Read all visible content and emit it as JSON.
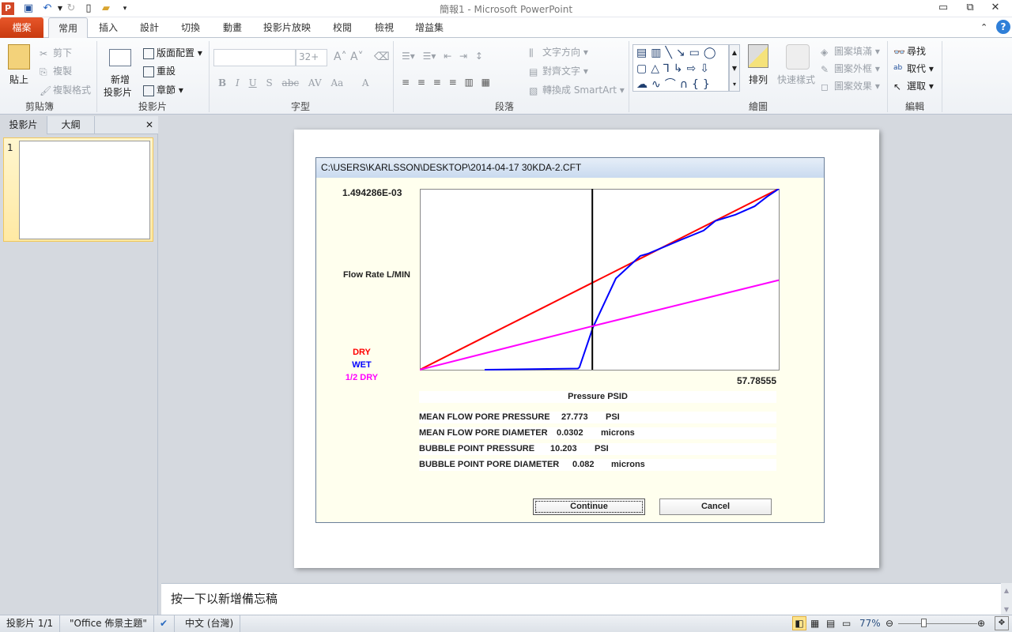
{
  "window": {
    "title": "簡報1 - Microsoft PowerPoint"
  },
  "tabs": [
    {
      "label": "檔案"
    },
    {
      "label": "常用"
    },
    {
      "label": "插入"
    },
    {
      "label": "設計"
    },
    {
      "label": "切換"
    },
    {
      "label": "動畫"
    },
    {
      "label": "投影片放映"
    },
    {
      "label": "校閱"
    },
    {
      "label": "檢視"
    },
    {
      "label": "增益集"
    }
  ],
  "ribbon": {
    "clipboard": {
      "label": "剪貼簿",
      "paste": "貼上",
      "cut": "剪下",
      "copy": "複製",
      "format_painter": "複製格式"
    },
    "slides": {
      "label": "投影片",
      "new_slide_1": "新增",
      "new_slide_2": "投影片",
      "layout": "版面配置",
      "reset": "重設",
      "section": "章節"
    },
    "font": {
      "label": "字型",
      "font_name": "",
      "font_size": "32+"
    },
    "paragraph": {
      "label": "段落",
      "text_direction": "文字方向",
      "align_text": "對齊文字",
      "smartart": "轉換成 SmartArt"
    },
    "drawing": {
      "label": "繪圖",
      "arrange": "排列",
      "quick_styles": "快速樣式",
      "shape_fill": "圖案填滿",
      "shape_outline": "圖案外框",
      "shape_effects": "圖案效果"
    },
    "editing": {
      "label": "編輯",
      "find": "尋找",
      "replace": "取代",
      "select": "選取"
    }
  },
  "left_pane": {
    "tabs": [
      "投影片",
      "大綱"
    ],
    "slide_number": "1"
  },
  "dialog": {
    "title": "C:\\USERS\\KARLSSON\\DESKTOP\\2014-04-17 30KDA-2.CFT",
    "stats": [
      {
        "label": "MEAN FLOW PORE PRESSURE",
        "value": "27.773",
        "unit": "PSI"
      },
      {
        "label": "MEAN FLOW PORE DIAMETER",
        "value": "0.0302",
        "unit": "microns"
      },
      {
        "label": "BUBBLE POINT PRESSURE",
        "value": "10.203",
        "unit": "PSI"
      },
      {
        "label": "BUBBLE POINT PORE DIAMETER",
        "value": "0.082",
        "unit": "microns"
      }
    ],
    "continue_label": "Continue",
    "cancel_label": "Cancel"
  },
  "chart_data": {
    "type": "line",
    "ylabel": "Flow Rate L/MIN",
    "xlabel": "Pressure PSID",
    "y_max_label": "1.494286E-03",
    "x_max_label": "57.78555",
    "xlim": [
      0,
      57.78555
    ],
    "ylim": [
      0,
      0.001494286
    ],
    "marker_x": 27.773,
    "series": [
      {
        "name": "DRY",
        "color": "#ff0000",
        "x": [
          0,
          10,
          20,
          27.8,
          36,
          45,
          57.79
        ],
        "y": [
          0,
          0.000259,
          0.000517,
          0.000719,
          0.000931,
          0.001164,
          0.001494
        ]
      },
      {
        "name": "WET",
        "color": "#0000ff",
        "x": [
          10.44,
          25.46,
          25.7,
          27.87,
          31.57,
          35.5,
          36.8,
          41.9,
          45.7,
          47.6,
          50.8,
          53.9,
          55.9,
          57.79
        ],
        "y": [
          0,
          1e-05,
          2e-05,
          0.00035,
          0.000754,
          0.00094,
          0.00096,
          0.00107,
          0.00115,
          0.00123,
          0.00128,
          0.00135,
          0.00143,
          0.001494
        ]
      },
      {
        "name": "1/2 DRY",
        "color": "#ff00ff",
        "x": [
          0,
          27.8,
          57.79
        ],
        "y": [
          0,
          0.00036,
          0.00074
        ]
      }
    ]
  },
  "notes": {
    "placeholder": "按一下以新增備忘稿"
  },
  "status": {
    "slide": "投影片 1/1",
    "theme": "\"Office 佈景主題\"",
    "language": "中文 (台灣)",
    "zoom": "77%",
    "zoom_percent": 77
  }
}
